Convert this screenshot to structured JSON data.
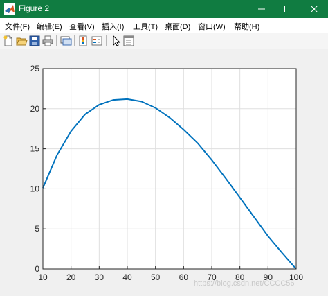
{
  "window": {
    "title": "Figure 2",
    "colors": {
      "titlebar": "#107c41",
      "line": "#0072bd",
      "axes_bg": "#ffffff",
      "figure_bg": "#f0f0f0"
    }
  },
  "menu": {
    "items": [
      "文件(F)",
      "编辑(E)",
      "查看(V)",
      "插入(I)",
      "工具(T)",
      "桌面(D)",
      "窗口(W)",
      "帮助(H)"
    ]
  },
  "toolbar": {
    "icons": [
      "new-figure-icon",
      "open-file-icon",
      "save-icon",
      "print-icon",
      "link-plot-icon",
      "insert-colorbar-icon",
      "insert-legend-icon",
      "pointer-icon",
      "property-editor-icon"
    ]
  },
  "watermark": "https://blog.csdn.net/CCCC56",
  "chart_data": {
    "type": "line",
    "title": "",
    "xlabel": "",
    "ylabel": "",
    "xlim": [
      10,
      100
    ],
    "ylim": [
      0,
      25
    ],
    "xticks": [
      10,
      20,
      30,
      40,
      50,
      60,
      70,
      80,
      90,
      100
    ],
    "yticks": [
      0,
      5,
      10,
      15,
      20,
      25
    ],
    "grid": true,
    "series": [
      {
        "x": [
          10,
          15,
          20,
          25,
          30,
          35,
          40,
          45,
          50,
          55,
          60,
          65,
          70,
          75,
          80,
          85,
          90,
          95,
          100
        ],
        "y": [
          10.1,
          14.2,
          17.2,
          19.3,
          20.5,
          21.1,
          21.2,
          20.9,
          20.1,
          18.9,
          17.4,
          15.7,
          13.6,
          11.3,
          8.9,
          6.5,
          4.1,
          2.0,
          0.0
        ]
      }
    ]
  }
}
